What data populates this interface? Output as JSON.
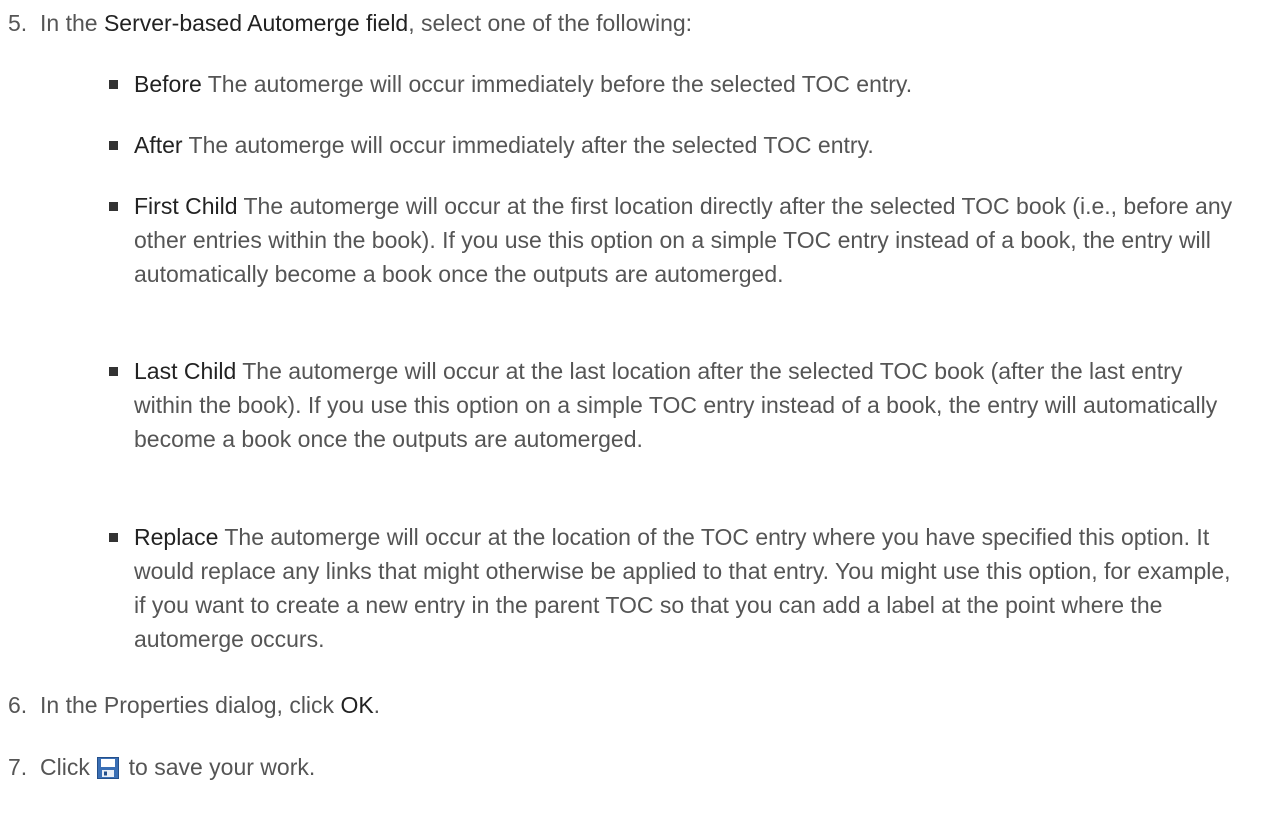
{
  "step5": {
    "number": "5.",
    "text_before": "In the ",
    "field_name": "Server-based Automerge field",
    "text_after": ", select one of the following:",
    "options": [
      {
        "term": "Before",
        "description": " The automerge will occur immediately before the selected TOC entry."
      },
      {
        "term": "After",
        "description": " The automerge will occur immediately after the selected TOC entry."
      },
      {
        "term": "First Child",
        "description": " The automerge will occur at the first location directly after the selected TOC book (i.e., before any other entries within the book). If you use this option on a simple TOC entry instead of a book, the entry will automatically become a book once the outputs are automerged."
      },
      {
        "term": "Last Child",
        "description": " The automerge will occur at the last location after the selected TOC book (after the last entry within the book). If you use this option on a simple TOC entry instead of a book, the entry will automatically become a book once the outputs are automerged."
      },
      {
        "term": "Replace",
        "description": " The automerge will occur at the location of the TOC entry where you have specified this option. It would replace any links that might otherwise be applied to that entry. You might use this option, for example, if you want to create a new entry in the parent TOC so that you can add a label at the point where the automerge occurs."
      }
    ]
  },
  "step6": {
    "number": "6.",
    "text_before": "In the Properties dialog, click ",
    "button_name": "OK",
    "text_after": "."
  },
  "step7": {
    "number": "7.",
    "text_before": "Click ",
    "icon": "save-icon",
    "text_after": " to save your work."
  },
  "colors": {
    "body_text": "#555555",
    "emphasis_text": "#222222",
    "bullet": "#333333",
    "icon_blue": "#3a6fb5"
  }
}
